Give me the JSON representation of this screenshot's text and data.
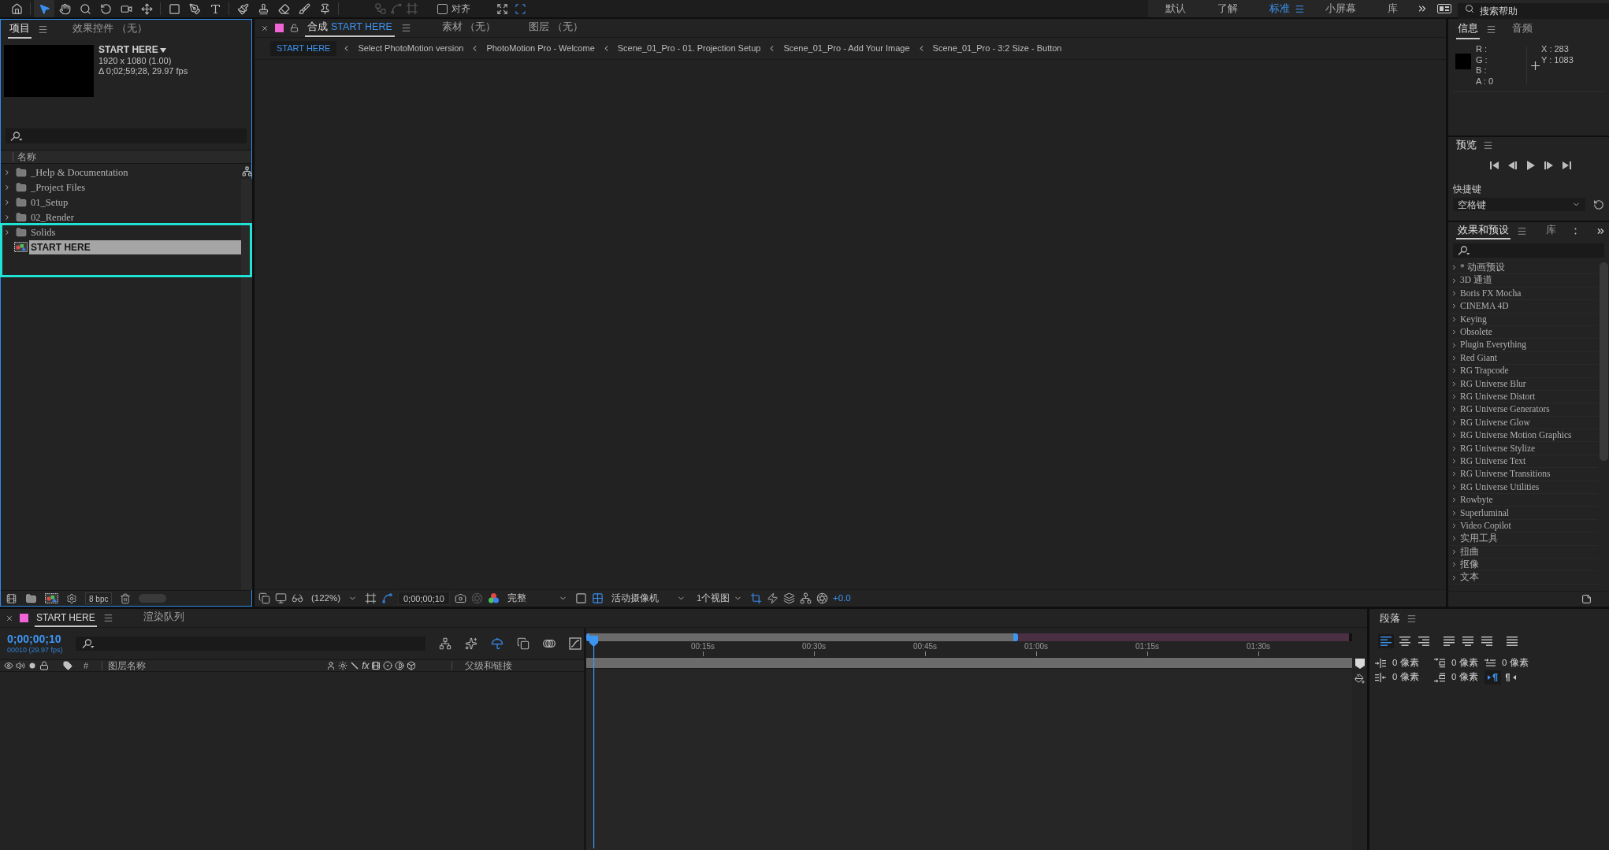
{
  "toolbar": {
    "tools": [
      {
        "kind": "home",
        "selected": false
      },
      {
        "kind": "select",
        "selected": true
      },
      {
        "kind": "hand",
        "selected": false
      },
      {
        "kind": "zoom",
        "selected": false
      },
      {
        "kind": "rotate",
        "selected": false
      },
      {
        "kind": "camera",
        "selected": false
      },
      {
        "kind": "pan",
        "selected": false
      },
      {
        "kind": "shape",
        "selected": false
      },
      {
        "kind": "pen",
        "selected": false
      },
      {
        "kind": "text",
        "selected": false
      },
      {
        "kind": "brush",
        "selected": false
      },
      {
        "kind": "stamp",
        "selected": false
      },
      {
        "kind": "eraser",
        "selected": false
      },
      {
        "kind": "roto",
        "selected": false
      },
      {
        "kind": "pin",
        "selected": false
      }
    ],
    "snap_options": [
      {
        "kind": "anchor",
        "disabled": true
      },
      {
        "kind": "points",
        "disabled": true
      },
      {
        "kind": "layers",
        "disabled": true
      }
    ],
    "snapping": {
      "label": "对齐",
      "checked": false
    },
    "snap_tools": [
      {
        "kind": "expand",
        "active": false
      },
      {
        "kind": "target",
        "active": true
      }
    ],
    "workspaces": [
      {
        "label": "默认",
        "selected": false
      },
      {
        "label": "了解",
        "selected": false
      },
      {
        "label": "标准",
        "selected": true
      },
      {
        "label": "小屏幕",
        "selected": false
      },
      {
        "label": "库",
        "selected": false
      }
    ],
    "help_search": {
      "placeholder": "搜索帮助"
    }
  },
  "project_panel": {
    "tabs": [
      {
        "label": "项目",
        "selected": true
      },
      {
        "label": "效果控件 （无）",
        "selected": false
      }
    ],
    "composition": {
      "name": "START HERE",
      "resolution": "1920 x 1080 (1.00)",
      "duration": "Δ 0;02;59;28, 29.97 fps"
    },
    "name_column": "名称",
    "items": [
      {
        "name": "_Help & Documentation",
        "kind": "folder",
        "expanded": false,
        "selected": false
      },
      {
        "name": "_Project Files",
        "kind": "folder",
        "expanded": false,
        "selected": false
      },
      {
        "name": "01_Setup",
        "kind": "folder",
        "expanded": false,
        "selected": false
      },
      {
        "name": "02_Render",
        "kind": "folder",
        "expanded": false,
        "selected": false
      },
      {
        "name": "Solids",
        "kind": "folder",
        "expanded": false,
        "selected": false
      },
      {
        "name": "START HERE",
        "kind": "composition",
        "selected": true
      }
    ],
    "bit_depth": "8 bpc"
  },
  "composition_panel": {
    "tabs": [
      {
        "label": "合成",
        "name": "START HERE",
        "color": "#f064d8",
        "locked": false,
        "selected": true
      },
      {
        "label": "素材 （无）",
        "selected": false
      },
      {
        "label": "图层 （无）",
        "selected": false
      }
    ],
    "breadcrumbs": [
      {
        "label": "START HERE",
        "selected": true
      },
      {
        "label": "Select PhotoMotion version",
        "selected": false
      },
      {
        "label": "PhotoMotion Pro - Welcome",
        "selected": false
      },
      {
        "label": "Scene_01_Pro - 01. Projection Setup",
        "selected": false
      },
      {
        "label": "Scene_01_Pro - Add Your Image",
        "selected": false
      },
      {
        "label": "Scene_01_Pro - 3:2 Size - Button",
        "selected": false
      }
    ],
    "viewer_bar": {
      "zoom": "(122%)",
      "timecode": "0;00;00;10",
      "resolution": "完整",
      "camera": "活动摄像机",
      "layout": "1个视图",
      "exposure": "+0.0"
    }
  },
  "info_panel": {
    "tabs": [
      {
        "label": "信息",
        "selected": true
      },
      {
        "label": "音频",
        "selected": false
      }
    ],
    "channels": [
      "R :",
      "G :",
      "B :",
      "A : 0"
    ],
    "position": [
      "X : 283",
      "Y : 1083"
    ]
  },
  "preview_panel": {
    "title": "预览",
    "shortcut_label": "快捷键",
    "shortcut": "空格键"
  },
  "effects_panel": {
    "tabs": [
      {
        "label": "效果和预设",
        "selected": true
      },
      {
        "label": "库",
        "selected": false
      }
    ],
    "categories": [
      {
        "label": "* 动画预设",
        "expanded": false
      },
      {
        "label": "3D 通道",
        "expanded": false
      },
      {
        "label": "Boris FX Mocha",
        "expanded": false
      },
      {
        "label": "CINEMA 4D",
        "expanded": false
      },
      {
        "label": "Keying",
        "expanded": false
      },
      {
        "label": "Obsolete",
        "expanded": false
      },
      {
        "label": "Plugin Everything",
        "expanded": false
      },
      {
        "label": "Red Giant",
        "expanded": false
      },
      {
        "label": "RG Trapcode",
        "expanded": false
      },
      {
        "label": "RG Universe Blur",
        "expanded": false
      },
      {
        "label": "RG Universe Distort",
        "expanded": false
      },
      {
        "label": "RG Universe Generators",
        "expanded": false
      },
      {
        "label": "RG Universe Glow",
        "expanded": false
      },
      {
        "label": "RG Universe Motion Graphics",
        "expanded": false
      },
      {
        "label": "RG Universe Stylize",
        "expanded": false
      },
      {
        "label": "RG Universe Text",
        "expanded": false
      },
      {
        "label": "RG Universe Transitions",
        "expanded": false
      },
      {
        "label": "RG Universe Utilities",
        "expanded": false
      },
      {
        "label": "Rowbyte",
        "expanded": false
      },
      {
        "label": "Superluminal",
        "expanded": false
      },
      {
        "label": "Video Copilot",
        "expanded": false
      },
      {
        "label": "实用工具",
        "expanded": false
      },
      {
        "label": "扭曲",
        "expanded": false
      },
      {
        "label": "抠像",
        "expanded": false
      },
      {
        "label": "文本",
        "expanded": false
      }
    ]
  },
  "timeline_panel": {
    "tabs": [
      {
        "label": "START HERE",
        "color": "#f064d8",
        "selected": true
      },
      {
        "label": "渲染队列",
        "selected": false
      }
    ],
    "timecode": "0;00;00;10",
    "frame_info": "00010 (29.97 fps)",
    "columns": {
      "number": "#",
      "layer_name": "图层名称",
      "effects": "fx",
      "parent": "父级和链接"
    },
    "ruler": [
      "00:15s",
      "00:30s",
      "00:45s",
      "01:00s",
      "01:15s",
      "01:30s"
    ],
    "navigator": {
      "level": 0.566
    },
    "playhead": {
      "level": 0.01
    }
  },
  "paragraph_panel": {
    "title": "段落",
    "alignments": [
      {
        "kind": "left",
        "selected": true
      },
      {
        "kind": "center",
        "selected": false
      },
      {
        "kind": "right",
        "selected": false
      },
      {
        "kind": "justify-left",
        "selected": false
      },
      {
        "kind": "justify-center",
        "selected": false
      },
      {
        "kind": "justify-right",
        "selected": false
      },
      {
        "kind": "justify-all",
        "selected": false
      }
    ],
    "spacing": [
      {
        "kind": "indent-left",
        "value": "0 像素"
      },
      {
        "kind": "space-before",
        "value": "0 像素"
      },
      {
        "kind": "indent-first",
        "value": "0 像素"
      },
      {
        "kind": "indent-right",
        "value": "0 像素"
      },
      {
        "kind": "space-after",
        "value": "0 像素"
      }
    ],
    "directions": [
      {
        "kind": "ltr",
        "selected": true
      },
      {
        "kind": "rtl",
        "selected": false
      }
    ]
  }
}
